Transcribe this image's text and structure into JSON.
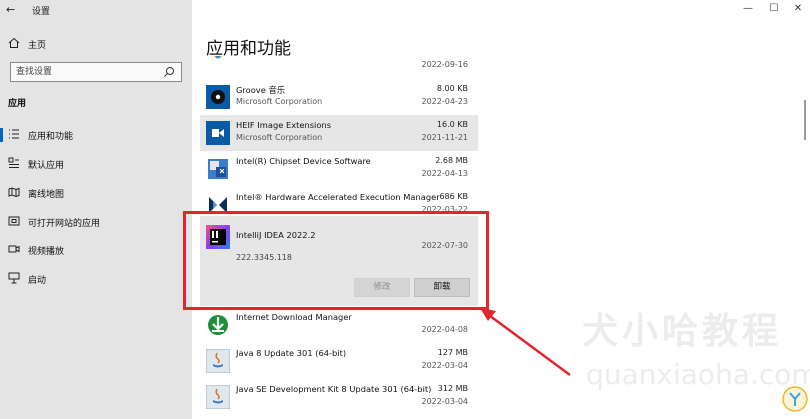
{
  "window": {
    "title": "设置",
    "back_glyph": "←",
    "minimize": "—",
    "maximize": "☐",
    "close": "✕"
  },
  "sidebar": {
    "home_label": "主页",
    "search_placeholder": "查找设置",
    "section_title": "应用",
    "items": [
      {
        "label": "应用和功能",
        "icon": "apps-features-icon",
        "active": true
      },
      {
        "label": "默认应用",
        "icon": "default-apps-icon"
      },
      {
        "label": "离线地图",
        "icon": "offline-maps-icon"
      },
      {
        "label": "可打开网站的应用",
        "icon": "apps-for-websites-icon"
      },
      {
        "label": "视频播放",
        "icon": "video-playback-icon"
      },
      {
        "label": "启动",
        "icon": "startup-icon"
      }
    ]
  },
  "main": {
    "title": "应用和功能",
    "apps": [
      {
        "name": "",
        "publisher": "",
        "size": "",
        "date": "2022-09-16",
        "icon": "chrome-icon"
      },
      {
        "name": "Groove 音乐",
        "publisher": "Microsoft Corporation",
        "size": "8.00 KB",
        "date": "2022-04-23",
        "icon": "groove-music-icon"
      },
      {
        "name": "HEIF Image Extensions",
        "publisher": "Microsoft Corporation",
        "size": "16.0 KB",
        "date": "2021-11-21",
        "icon": "heif-extension-icon"
      },
      {
        "name": "Intel(R) Chipset Device Software",
        "publisher": "",
        "size": "2.68 MB",
        "date": "2022-04-13",
        "icon": "intel-chipset-icon"
      },
      {
        "name": "Intel® Hardware Accelerated Execution Manager",
        "publisher": "",
        "size": "686 KB",
        "date": "2022-03-22",
        "icon": "intel-haxm-icon"
      }
    ],
    "expanded_app": {
      "name": "IntelliJ IDEA 2022.2",
      "date": "2022-07-30",
      "version": "222.3345.118",
      "modify_label": "修改",
      "uninstall_label": "卸载",
      "icon": "intellij-idea-icon"
    },
    "apps_after": [
      {
        "name": "Internet Download Manager",
        "publisher": "",
        "size": "",
        "date": "2022-04-08",
        "icon": "idm-icon"
      },
      {
        "name": "Java 8 Update 301 (64-bit)",
        "publisher": "",
        "size": "127 MB",
        "date": "2022-03-04",
        "icon": "java-icon"
      },
      {
        "name": "Java SE Development Kit 8 Update 301 (64-bit)",
        "publisher": "",
        "size": "312 MB",
        "date": "2022-03-04",
        "icon": "java-jdk-icon"
      }
    ]
  },
  "watermark": {
    "text_cn": "犬小哈教程",
    "text_en": "quanxiaoha.com"
  },
  "colors": {
    "annotation_red": "#e3262d",
    "accent_blue": "#0067c0",
    "sidebar_bg": "#e4e4e4"
  }
}
